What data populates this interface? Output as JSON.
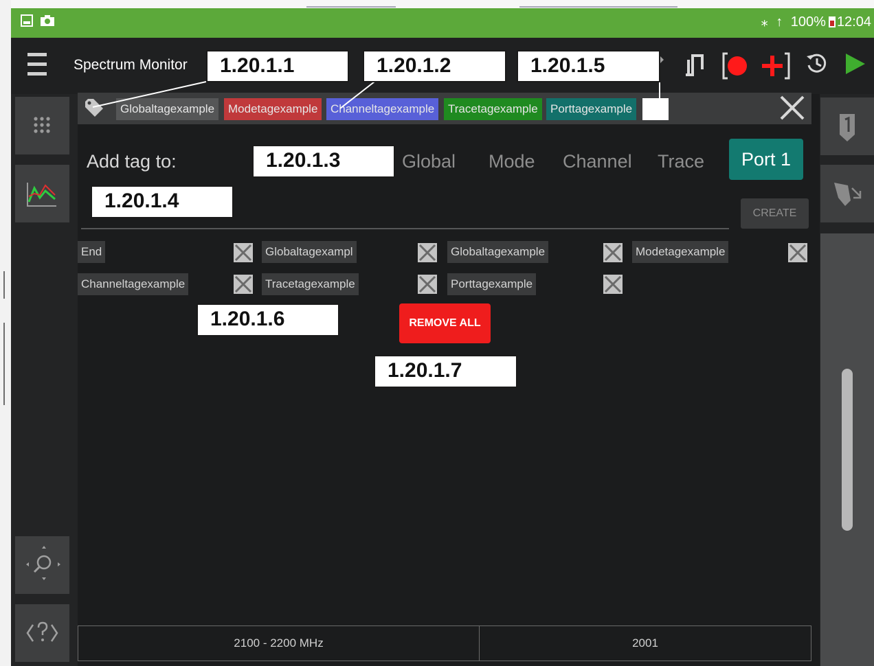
{
  "status_bar": {
    "battery": "100%",
    "time": "12:04"
  },
  "toolbar": {
    "title": "Spectrum Monitor"
  },
  "tag_bar": {
    "chips": [
      {
        "label": "Globaltagexample",
        "color": "#555657"
      },
      {
        "label": "Modetagexample",
        "color": "#c0393b"
      },
      {
        "label": "Channeltagexample",
        "color": "#5860d8"
      },
      {
        "label": "Tracetagexample",
        "color": "#1f8a20"
      },
      {
        "label": "Porttagexample",
        "color": "#13706a"
      }
    ]
  },
  "panel": {
    "add_tag_label": "Add tag to:",
    "targets": [
      "Global",
      "Mode",
      "Channel",
      "Trace",
      "Port 1"
    ],
    "selected_target": "Port 1",
    "create_label": "CREATE",
    "tag_rows": [
      [
        "End",
        "Globaltagexampl",
        "Globaltagexample",
        "Modetagexample"
      ],
      [
        "Channeltagexample",
        "Tracetagexample",
        "Porttagexample"
      ]
    ],
    "remove_all_label": "REMOVE ALL"
  },
  "bottom_bar": {
    "frequency": "2100 - 2200  MHz",
    "value": "2001"
  },
  "callouts": [
    "1.20.1.1",
    "1.20.1.2",
    "1.20.1.5",
    "1.20.1.3",
    "1.20.1.4",
    "1.20.1.6",
    "1.20.1.7"
  ],
  "colors": {
    "status_bar": "#5ca93a",
    "accent_teal": "#137a70",
    "remove_red": "#ef1d1d",
    "record_red": "#ff1a1a",
    "play_green": "#3fae2f"
  }
}
